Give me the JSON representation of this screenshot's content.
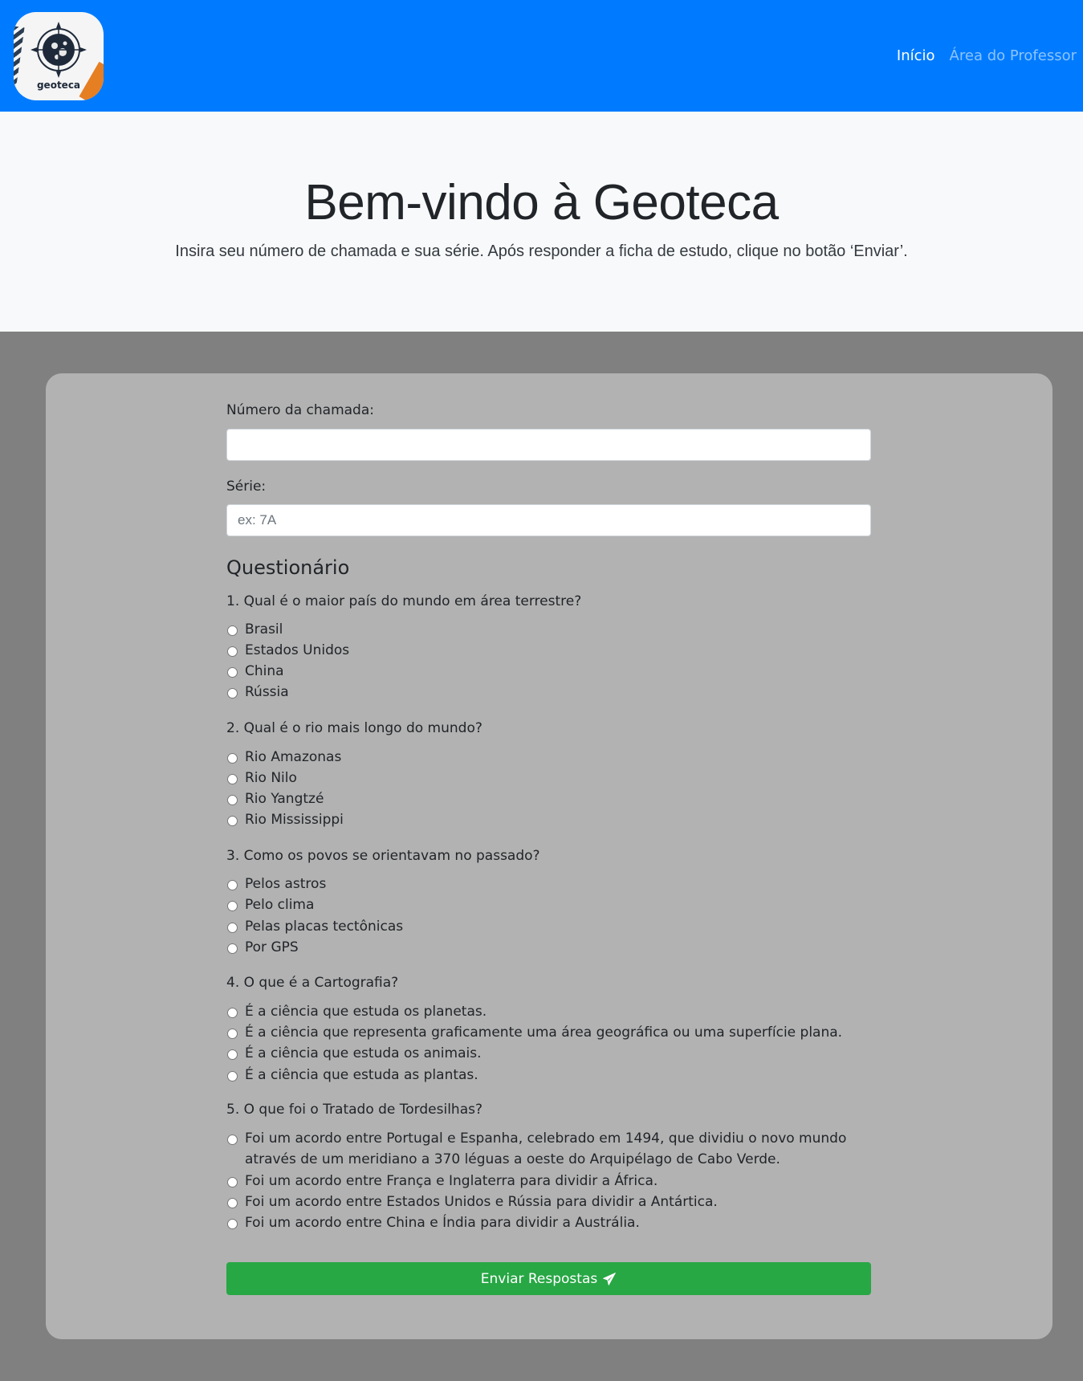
{
  "nav": {
    "logo_text": "geoteca",
    "links": [
      {
        "label": "Início"
      },
      {
        "label": "Área do Professor"
      }
    ]
  },
  "hero": {
    "title": "Bem-vindo à Geoteca",
    "subtitle": "Insira seu número de chamada e sua série. Após responder a ficha de estudo, clique no botão ‘Enviar’."
  },
  "form": {
    "chamada_label": "Número da chamada:",
    "chamada_value": "",
    "serie_label": "Série:",
    "serie_placeholder": "ex: 7A",
    "section_title": "Questionário",
    "questions": [
      {
        "text": "1. Qual é o maior país do mundo em área terrestre?",
        "options": [
          "Brasil",
          "Estados Unidos",
          "China",
          "Rússia"
        ]
      },
      {
        "text": "2. Qual é o rio mais longo do mundo?",
        "options": [
          "Rio Amazonas",
          "Rio Nilo",
          "Rio Yangtzé",
          "Rio Mississippi"
        ]
      },
      {
        "text": "3. Como os povos se orientavam no passado?",
        "options": [
          "Pelos astros",
          "Pelo clima",
          "Pelas placas tectônicas",
          "Por GPS"
        ]
      },
      {
        "text": "4. O que é a Cartografia?",
        "options": [
          "É a ciência que estuda os planetas.",
          "É a ciência que representa graficamente uma área geográfica ou uma superfície plana.",
          "É a ciência que estuda os animais.",
          "É a ciência que estuda as plantas."
        ]
      },
      {
        "text": "5. O que foi o Tratado de Tordesilhas?",
        "options": [
          "Foi um acordo entre Portugal e Espanha, celebrado em 1494, que dividiu o novo mundo através de um meridiano a 370 léguas a oeste do Arquipélago de Cabo Verde.",
          "Foi um acordo entre França e Inglaterra para dividir a África.",
          "Foi um acordo entre Estados Unidos e Rússia para dividir a Antártica.",
          "Foi um acordo entre China e Índia para dividir a Austrália."
        ]
      }
    ],
    "submit_label": "Enviar Respostas",
    "submit_icon": "paper-plane-icon"
  },
  "colors": {
    "navbar": "#007bff",
    "hero_bg": "#f8f9fa",
    "page_bg": "#808080",
    "card_bg": "#b2b2b2",
    "submit": "#28a745"
  }
}
